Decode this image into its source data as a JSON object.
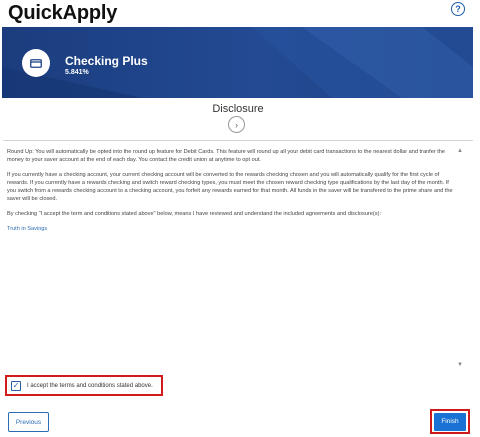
{
  "app": {
    "title": "QuickApply",
    "help_icon": "?"
  },
  "account": {
    "icon": "card-icon",
    "name": "Checking Plus",
    "rate": "5.841%"
  },
  "disclosure": {
    "title": "Disclosure",
    "paragraphs": [
      "Round Up: You will automatically be opted into the round up feature for Debit Cards. This feature will round up all your debit card transactions to the nearest dollar and tranfer the money to your saver account at the end of each day. You contact the credit union at anytime to opt out.",
      "If you currently have a checking account, your current checking account will be converted to the rewards checking chosen and you will automatically qualify for the first cycle of rewards. If you currently have a rewards checking and switch reward checking types, you must meet the chosen reward checking type qualifications by the last day of the month. If you switch from a rewards checking account to a checking account, you forfeit any rewards earned for that month. All funds in the saver will be transfered to the prime share and the saver will be closed.",
      "By checking \"I accept the term and conditions stated above\" below, means I have reviewed and understand the included agreements and  disclosure(s):"
    ],
    "link": "Truth in Savings"
  },
  "accept": {
    "checked": true,
    "label": "I accept the terms and conditions stated above."
  },
  "nav": {
    "previous": "Previous",
    "finish": "Finish"
  },
  "colors": {
    "banner": "#1f4389",
    "accent": "#1a73d4",
    "highlight": "#d0191b"
  }
}
